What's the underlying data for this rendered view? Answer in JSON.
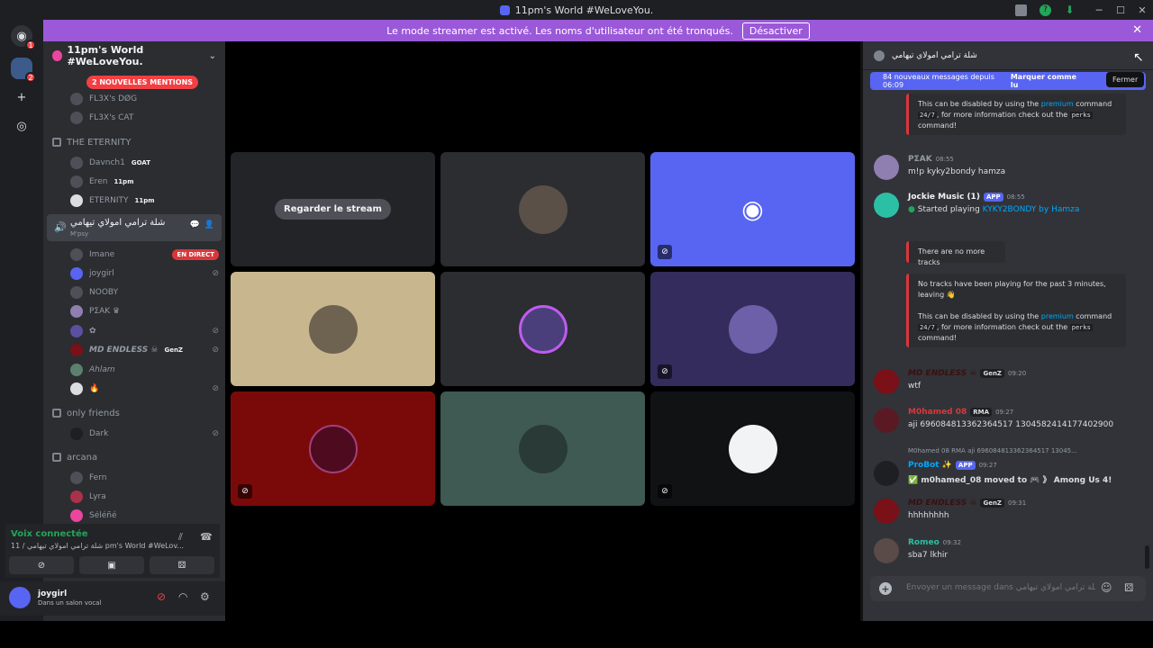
{
  "window": {
    "title": "11pm's World #WeLoveYou."
  },
  "banner": {
    "text": "Le mode streamer est activé. Les noms d'utilisateur ont été tronqués.",
    "button": "Désactiver"
  },
  "guilds": {
    "badge1": "1",
    "badge2": "2"
  },
  "server": {
    "name": "11pm's World #WeLoveYou.",
    "mentions": "2 NOUVELLES MENTIONS"
  },
  "channels": {
    "the_eternity": "THE ETERNITY",
    "only_friends": "only friends",
    "arcana": "arcana",
    "active_name": "شلة ترامي امولاي تيهامي",
    "active_sub": "M'psy"
  },
  "members": {
    "top1": "FL3X's DØG",
    "top2": "FL3X's CAT",
    "eternity": [
      {
        "name": "Davnch1",
        "tag": "GOAT"
      },
      {
        "name": "Eren",
        "tag": "11pm"
      },
      {
        "name": "ETERNITY",
        "tag": "11pm"
      }
    ],
    "voice": [
      {
        "name": "Imane",
        "live": "EN DIRECT"
      },
      {
        "name": "joygirl"
      },
      {
        "name": "NOOBY"
      },
      {
        "name": "PΣAK ♛"
      },
      {
        "name": "✿"
      },
      {
        "name": "MD ENDLESS ☠",
        "tag": "GenZ"
      },
      {
        "name": "Ahlam"
      },
      {
        "name": "🔥"
      }
    ],
    "dark": "Dark",
    "arcana": [
      {
        "name": "Fern"
      },
      {
        "name": "Lyra"
      },
      {
        "name": "Séléñé"
      }
    ]
  },
  "voice_panel": {
    "status": "Voix connectée",
    "sub": "11 / شلة ترامي امولاي تيهامي pm's World #WeLov..."
  },
  "user": {
    "name": "joygirl",
    "status": "Dans un salon vocal"
  },
  "stage": {
    "watch": "Regarder le stream"
  },
  "chat": {
    "channel": "شلة ترامي امولاي تيهامي",
    "new_messages": "84 nouveaux messages depuis 06:09",
    "mark": "Marquer comme lu",
    "close_tip": "Fermer",
    "embed1": {
      "pre": "This can be disabled by using the ",
      "link": "premium",
      "mid": " command ",
      "cmd1": "24/7",
      "mid2": ", for more information check out the ",
      "cmd2": "perks",
      "post": " command!"
    },
    "m1": {
      "name": "PΣAK",
      "time": "08:55",
      "body": "m!p kyky2bondy hamza"
    },
    "m2": {
      "name": "Jockie Music (1)",
      "app": "APP",
      "time": "08:55",
      "body_pre": "Started playing ",
      "body_link": "KYKY2BONDY by Hamza"
    },
    "embed2": {
      "text": "There are no more tracks"
    },
    "embed3": {
      "line1": "No tracks have been playing for the past 3 minutes, leaving 👋"
    },
    "m3": {
      "name": "MD ENDLESS ☠",
      "tag": "GenZ",
      "time": "09:20",
      "body": "wtf"
    },
    "m4": {
      "name": "M0hamed 08",
      "tag": "RMA",
      "time": "09:27",
      "body": "aji 696084813362364517 1304582414177402900"
    },
    "m5": {
      "reply": "M0hamed 08  RMA  aji 696084813362364517 13045...",
      "name": "ProBot ✨",
      "app": "APP",
      "time": "09:27",
      "body": "✅ m0hamed_08 moved to 🎮 》 Among Us 4!"
    },
    "m6": {
      "name": "MD ENDLESS ☠",
      "tag": "GenZ",
      "time": "09:31",
      "body": "hhhhhhhh"
    },
    "m7": {
      "name": "Romeo",
      "time": "09:32",
      "body": "sba7 lkhir"
    },
    "placeholder": "Envoyer un message dans شلة ترامي امولاي تيهامي"
  },
  "colors": {
    "accent": "#5865f2",
    "banner": "#9b59d9",
    "live": "#da373c",
    "online": "#23a55a"
  }
}
